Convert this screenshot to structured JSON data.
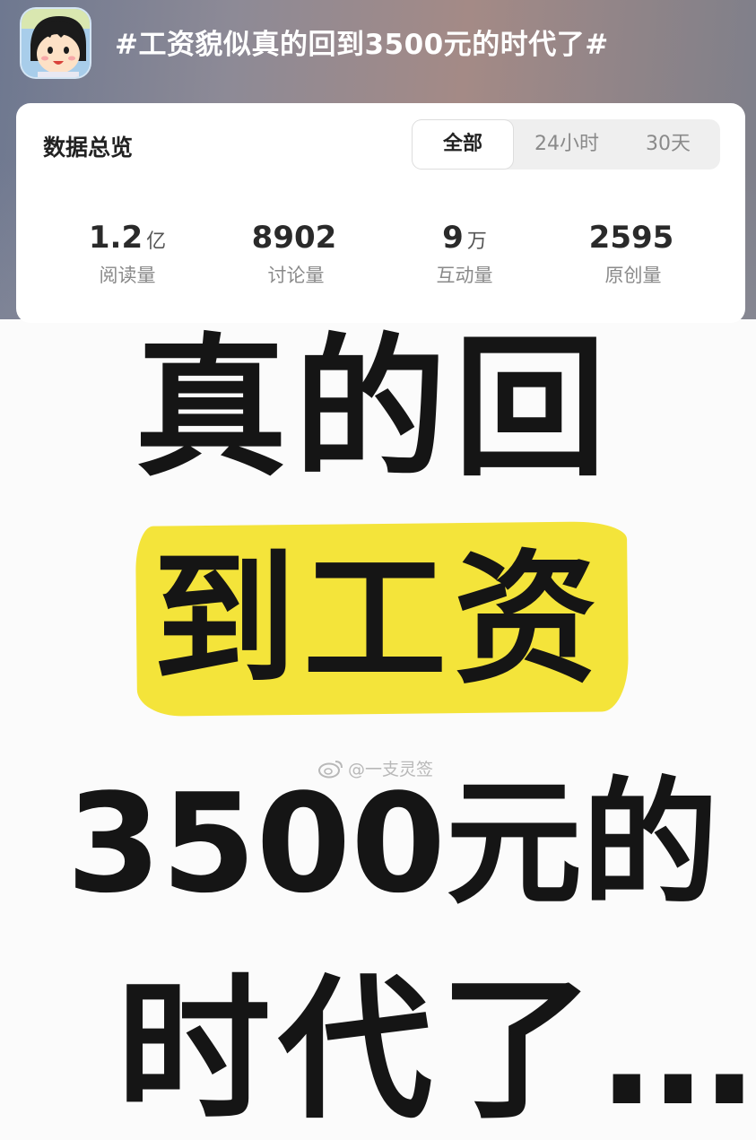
{
  "topic": {
    "title": "#工资貌似真的回到3500元的时代了#"
  },
  "overview": {
    "title": "数据总览",
    "tabs": [
      {
        "label": "全部",
        "active": true
      },
      {
        "label": "24小时",
        "active": false
      },
      {
        "label": "30天",
        "active": false
      }
    ],
    "stats": [
      {
        "value": "1.2",
        "unit": "亿",
        "label": "阅读量"
      },
      {
        "value": "8902",
        "unit": "",
        "label": "讨论量"
      },
      {
        "value": "9",
        "unit": "万",
        "label": "互动量"
      },
      {
        "value": "2595",
        "unit": "",
        "label": "原创量"
      }
    ]
  },
  "poster": {
    "lines": [
      "真的回",
      "到工资",
      "3500元的",
      "时代了…"
    ],
    "highlight_color": "#f4e43a",
    "watermark": "@一支灵签"
  }
}
